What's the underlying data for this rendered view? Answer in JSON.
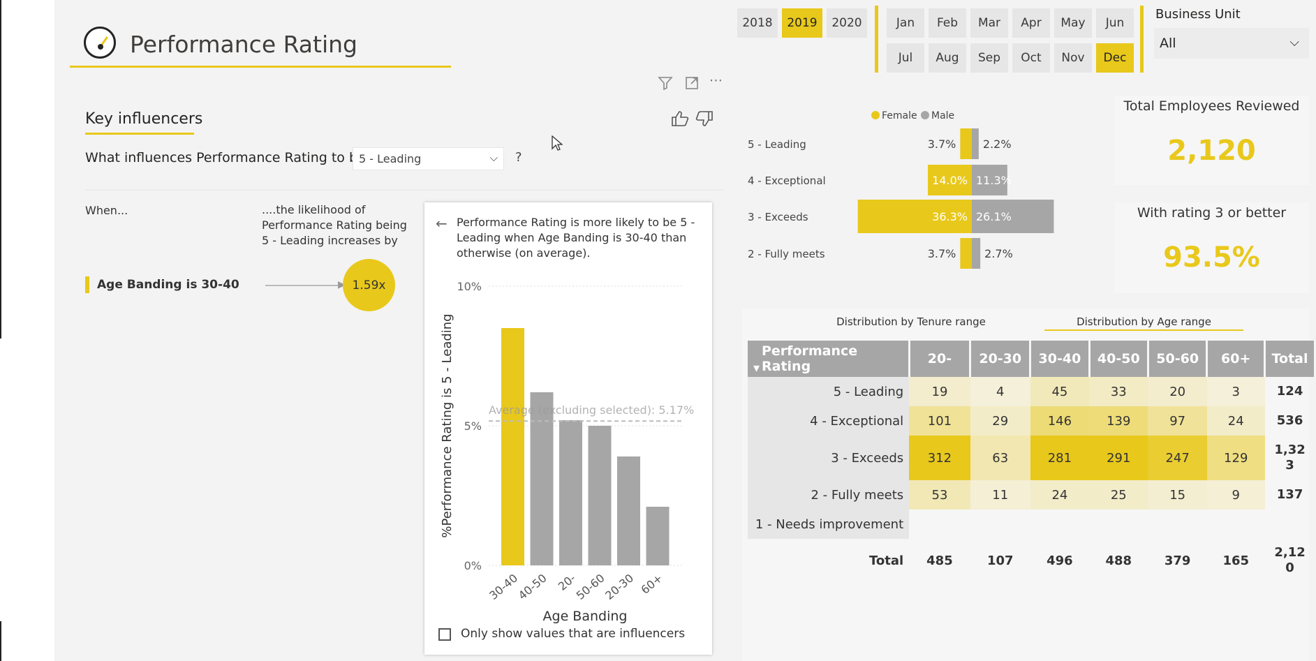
{
  "header": {
    "title": "Performance Rating"
  },
  "years": [
    {
      "label": "2018",
      "selected": false
    },
    {
      "label": "2019",
      "selected": true
    },
    {
      "label": "2020",
      "selected": false
    }
  ],
  "months_row1": [
    {
      "label": "Jan",
      "selected": false
    },
    {
      "label": "Feb",
      "selected": false
    },
    {
      "label": "Mar",
      "selected": false
    },
    {
      "label": "Apr",
      "selected": false
    },
    {
      "label": "May",
      "selected": false
    },
    {
      "label": "Jun",
      "selected": false
    }
  ],
  "months_row2": [
    {
      "label": "Jul",
      "selected": false
    },
    {
      "label": "Aug",
      "selected": false
    },
    {
      "label": "Sep",
      "selected": false
    },
    {
      "label": "Oct",
      "selected": false
    },
    {
      "label": "Nov",
      "selected": false
    },
    {
      "label": "Dec",
      "selected": true
    }
  ],
  "business_unit": {
    "label": "Business Unit",
    "value": "All"
  },
  "key_influencers": {
    "title": "Key influencers",
    "question": "What influences Performance Rating to be",
    "target_value": "5 - Leading",
    "question_mark": "?",
    "when_label": "When...",
    "likelihood_label": "....the likelihood of Performance Rating being 5 - Leading increases by",
    "influencer": {
      "label": "Age Banding is 30-40",
      "multiplier": "1.59x"
    },
    "detail": {
      "description": "Performance Rating is more likely to be 5 - Leading when Age Banding is 30-40 than otherwise (on average).",
      "checkbox_label": "Only show values that are influencers"
    }
  },
  "kpis": [
    {
      "title": "Total Employees Reviewed",
      "value": "2,120"
    },
    {
      "title": "With rating 3 or better",
      "value": "93.5%"
    }
  ],
  "matrix": {
    "tabs": [
      {
        "label": "Distribution by Tenure range",
        "active": false
      },
      {
        "label": "Distribution by Age range",
        "active": true
      }
    ],
    "columns": [
      "Performance Rating",
      "20-",
      "20-30",
      "30-40",
      "40-50",
      "50-60",
      "60+",
      "Total"
    ],
    "rows": [
      {
        "label": "5 - Leading",
        "cells": [
          "19",
          "4",
          "45",
          "33",
          "20",
          "3"
        ],
        "total": "124"
      },
      {
        "label": "4 - Exceptional",
        "cells": [
          "101",
          "29",
          "146",
          "139",
          "97",
          "24"
        ],
        "total": "536"
      },
      {
        "label": "3 - Exceeds",
        "cells": [
          "312",
          "63",
          "281",
          "291",
          "247",
          "129"
        ],
        "total": "1,32\n3"
      },
      {
        "label": "2 - Fully meets",
        "cells": [
          "53",
          "11",
          "24",
          "25",
          "15",
          "9"
        ],
        "total": "137"
      },
      {
        "label": "1 - Needs improvement",
        "cells": [
          "",
          "",
          "",
          "",
          "",
          ""
        ],
        "total": ""
      }
    ],
    "total_row": {
      "label": "Total",
      "cells": [
        "485",
        "107",
        "496",
        "488",
        "379",
        "165"
      ],
      "total": "2,12\n0"
    },
    "heat": [
      [
        0.06,
        0.01,
        0.15,
        0.11,
        0.06,
        0.01
      ],
      [
        0.32,
        0.09,
        0.47,
        0.45,
        0.31,
        0.08
      ],
      [
        1.0,
        0.2,
        0.9,
        0.93,
        0.79,
        0.41
      ],
      [
        0.17,
        0.03,
        0.08,
        0.08,
        0.05,
        0.03
      ],
      [
        0,
        0,
        0,
        0,
        0,
        0
      ]
    ]
  },
  "colors": {
    "accent": "#e8c81b",
    "female": "#e8c81b",
    "male": "#a6a6a6"
  },
  "chart_data": [
    {
      "type": "bar",
      "categories": [
        "30-40",
        "40-50",
        "20-",
        "50-60",
        "20-30",
        "60+"
      ],
      "values": [
        8.5,
        6.2,
        5.2,
        5.0,
        3.9,
        2.1
      ],
      "highlight": "30-40",
      "xlabel": "Age Banding",
      "ylabel": "%Performance Rating is 5 - Leading",
      "yticks": [
        "0%",
        "5%",
        "10%"
      ],
      "ylim": [
        0,
        10
      ],
      "average": {
        "value": 5.17,
        "label": "Average (excluding selected): 5.17%"
      }
    },
    {
      "type": "bar",
      "orientation": "diverging",
      "categories": [
        "5 - Leading",
        "4 - Exceptional",
        "3 - Exceeds",
        "2 - Fully meets"
      ],
      "series": [
        {
          "name": "Female",
          "values": [
            3.7,
            14.0,
            36.3,
            3.7
          ],
          "labels": [
            "3.7%",
            "14.0%",
            "36.3%",
            "3.7%"
          ]
        },
        {
          "name": "Male",
          "values": [
            2.2,
            11.3,
            26.1,
            2.7
          ],
          "labels": [
            "2.2%",
            "11.3%",
            "26.1%",
            "2.7%"
          ]
        }
      ],
      "legend": "top"
    }
  ]
}
